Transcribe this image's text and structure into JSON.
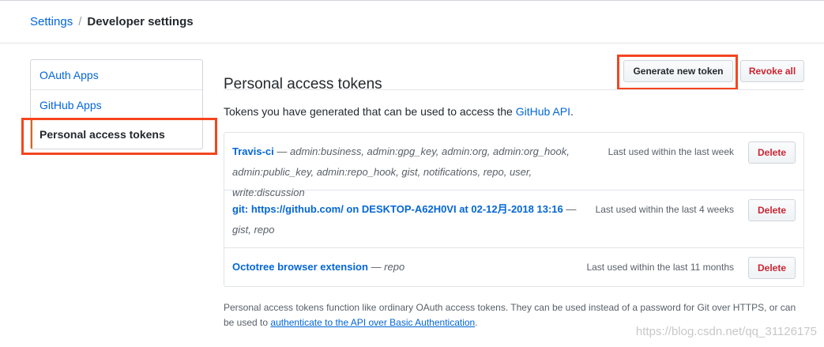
{
  "breadcrumb": {
    "root": "Settings",
    "separator": "/",
    "current": "Developer settings"
  },
  "sidebar": {
    "items": [
      {
        "label": "OAuth Apps"
      },
      {
        "label": "GitHub Apps"
      },
      {
        "label": "Personal access tokens",
        "selected": true
      }
    ]
  },
  "main": {
    "title": "Personal access tokens",
    "generate_label": "Generate new token",
    "revoke_all_label": "Revoke all",
    "intro_prefix": "Tokens you have generated that can be used to access the ",
    "intro_link": "GitHub API",
    "intro_suffix": "."
  },
  "tokens": [
    {
      "name": "Travis-ci",
      "scopes": " — admin:business, admin:gpg_key, admin:org, admin:org_hook, admin:public_key, admin:repo_hook, gist, notifications, repo, user, write:discussion",
      "last_used": "Last used within the last week",
      "delete_label": "Delete"
    },
    {
      "name": "git: https://github.com/ on DESKTOP-A62H0VI at 02-12月-2018 13:16",
      "scopes": " — gist, repo",
      "last_used": "Last used within the last 4 weeks",
      "delete_label": "Delete"
    },
    {
      "name": "Octotree browser extension",
      "scopes": " — repo",
      "last_used": "Last used within the last 11 months",
      "delete_label": "Delete"
    }
  ],
  "footer": {
    "text_before": "Personal access tokens function like ordinary OAuth access tokens. They can be used instead of a password for Git over HTTPS, or can be used to ",
    "link": "authenticate to the API over Basic Authentication",
    "text_after": "."
  },
  "watermark": "https://blog.csdn.net/qq_31126175",
  "colors": {
    "link": "#0366d6",
    "danger": "#cb2431",
    "highlight_box": "#f5451f",
    "selected_bar": "#e36209"
  }
}
